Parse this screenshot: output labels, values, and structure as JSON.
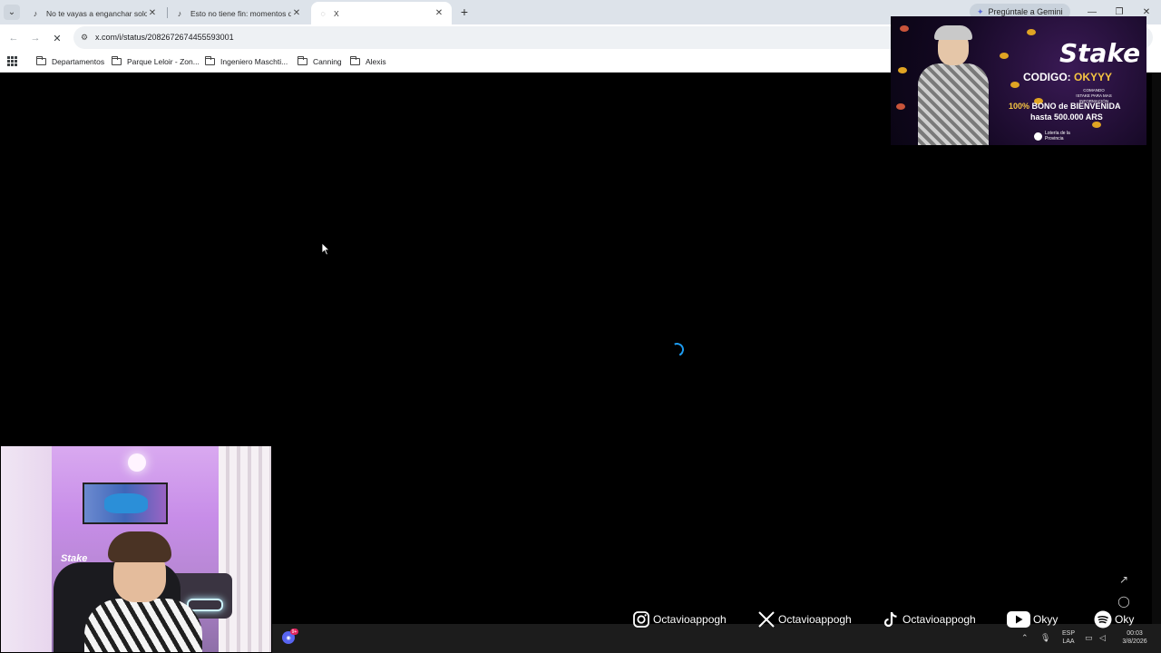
{
  "tabs": [
    {
      "title": "No te vayas a enganchar solo f",
      "icon": "tiktok-icon",
      "active": false
    },
    {
      "title": "Esto no tiene fin: momentos di",
      "icon": "tiktok-icon",
      "active": false
    },
    {
      "title": "X",
      "icon": "loading-icon",
      "active": true
    }
  ],
  "gemini_label": "Pregúntale a Gemini",
  "url": "x.com/i/status/2082672674455593001",
  "bookmarks": [
    "Departamentos",
    "Parque Leloir - Zon...",
    "Ingeniero Maschti...",
    "Canning",
    "Alexis"
  ],
  "ad": {
    "logo": "Stake",
    "code_label": "CODIGO:",
    "code_value": "OKYYY",
    "command_text": "COMANDO !STAKE PARA MAS INFORMACIÓN",
    "bonus_highlight": "100%",
    "bonus_text": "BONO de BIENVENIDA",
    "amount": "hasta 500.000 ARS",
    "loteria": "Lotería de la Provincia"
  },
  "webcam": {
    "chair_text": "Stake"
  },
  "socials": [
    {
      "icon": "instagram-icon",
      "label": "Octavioappogh"
    },
    {
      "icon": "x-icon",
      "label": "Octavioappogh"
    },
    {
      "icon": "tiktok-icon",
      "label": "Octavioappogh"
    },
    {
      "icon": "youtube-icon",
      "label": "Okyy"
    },
    {
      "icon": "spotify-icon",
      "label": "Oky"
    }
  ],
  "taskbar": {
    "discord_badge": "9+",
    "language": "ESP",
    "layout": "LAA",
    "time": "00:03",
    "date": "3/8/2026"
  },
  "colors": {
    "tabstrip": "#dde3ea",
    "spinner": "#1d9bf0",
    "ad_accent": "#f6c542"
  }
}
